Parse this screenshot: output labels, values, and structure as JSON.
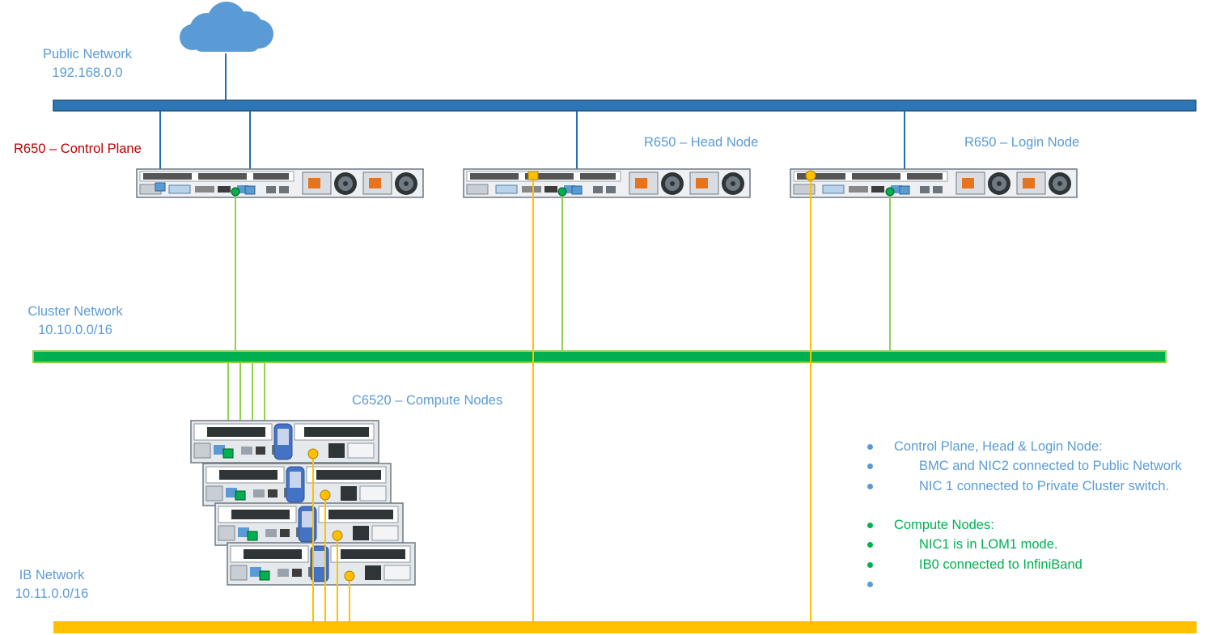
{
  "networks": {
    "public": {
      "name": "Public Network",
      "subnet": "192.168.0.0",
      "color": "#2e75b6"
    },
    "cluster": {
      "name": "Cluster Network",
      "subnet": "10.10.0.0/16",
      "color": "#00b050"
    },
    "ib": {
      "name": "IB Network",
      "subnet": "10.11.0.0/16",
      "color": "#ffc000"
    }
  },
  "nodes": {
    "control_plane": {
      "label": "R650 – Control Plane",
      "color": "#c00000"
    },
    "head": {
      "label": "R650 –  Head Node"
    },
    "login": {
      "label": "R650 – Login Node"
    },
    "compute": {
      "label": "C6520 – Compute Nodes",
      "count": 4
    }
  },
  "notes": [
    {
      "text": "Control Plane, Head & Login Node:",
      "style": "blue",
      "indent": false
    },
    {
      "text": "BMC and NIC2 connected to Public Network",
      "style": "blue",
      "indent": true
    },
    {
      "text": "NIC 1 connected to Private Cluster switch.",
      "style": "blue",
      "indent": true
    },
    {
      "text": "Compute Nodes:",
      "style": "green",
      "indent": false
    },
    {
      "text": "NIC1 is in LOM1 mode.",
      "style": "green",
      "indent": true
    },
    {
      "text": "IB0 connected to InfiniBand",
      "style": "green",
      "indent": true
    },
    {
      "text": "",
      "style": "blue",
      "indent": false
    }
  ],
  "colors": {
    "text": "#5b9bd5",
    "cloud": "#5b9bd5",
    "public_link": "#1f6fb5",
    "cluster_link": "#92d050",
    "ib_link": "#ffc000"
  }
}
